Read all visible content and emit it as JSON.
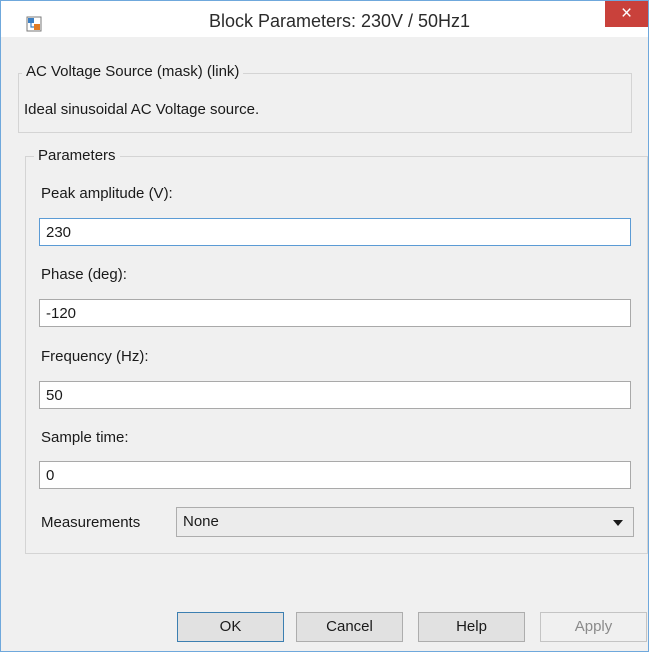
{
  "window": {
    "title": "Block Parameters: 230V / 50Hz1",
    "close_symbol": "×",
    "icon": "simulink-block-icon"
  },
  "mask": {
    "legend": "AC Voltage Source (mask) (link)",
    "description": "Ideal sinusoidal AC Voltage source."
  },
  "parameters": {
    "legend": "Parameters",
    "peak_amplitude": {
      "label": "Peak amplitude (V):",
      "value": "230"
    },
    "phase": {
      "label": "Phase (deg):",
      "value": "-120"
    },
    "frequency": {
      "label": "Frequency (Hz):",
      "value": "50"
    },
    "sample_time": {
      "label": "Sample time:",
      "value": "0"
    },
    "measurements": {
      "label": "Measurements",
      "selected": "None"
    }
  },
  "buttons": {
    "ok": "OK",
    "cancel": "Cancel",
    "help": "Help",
    "apply": "Apply"
  },
  "colors": {
    "close_button": "#c9413b",
    "focus_border": "#5b9bd5",
    "window_bg": "#f0f0f0"
  }
}
